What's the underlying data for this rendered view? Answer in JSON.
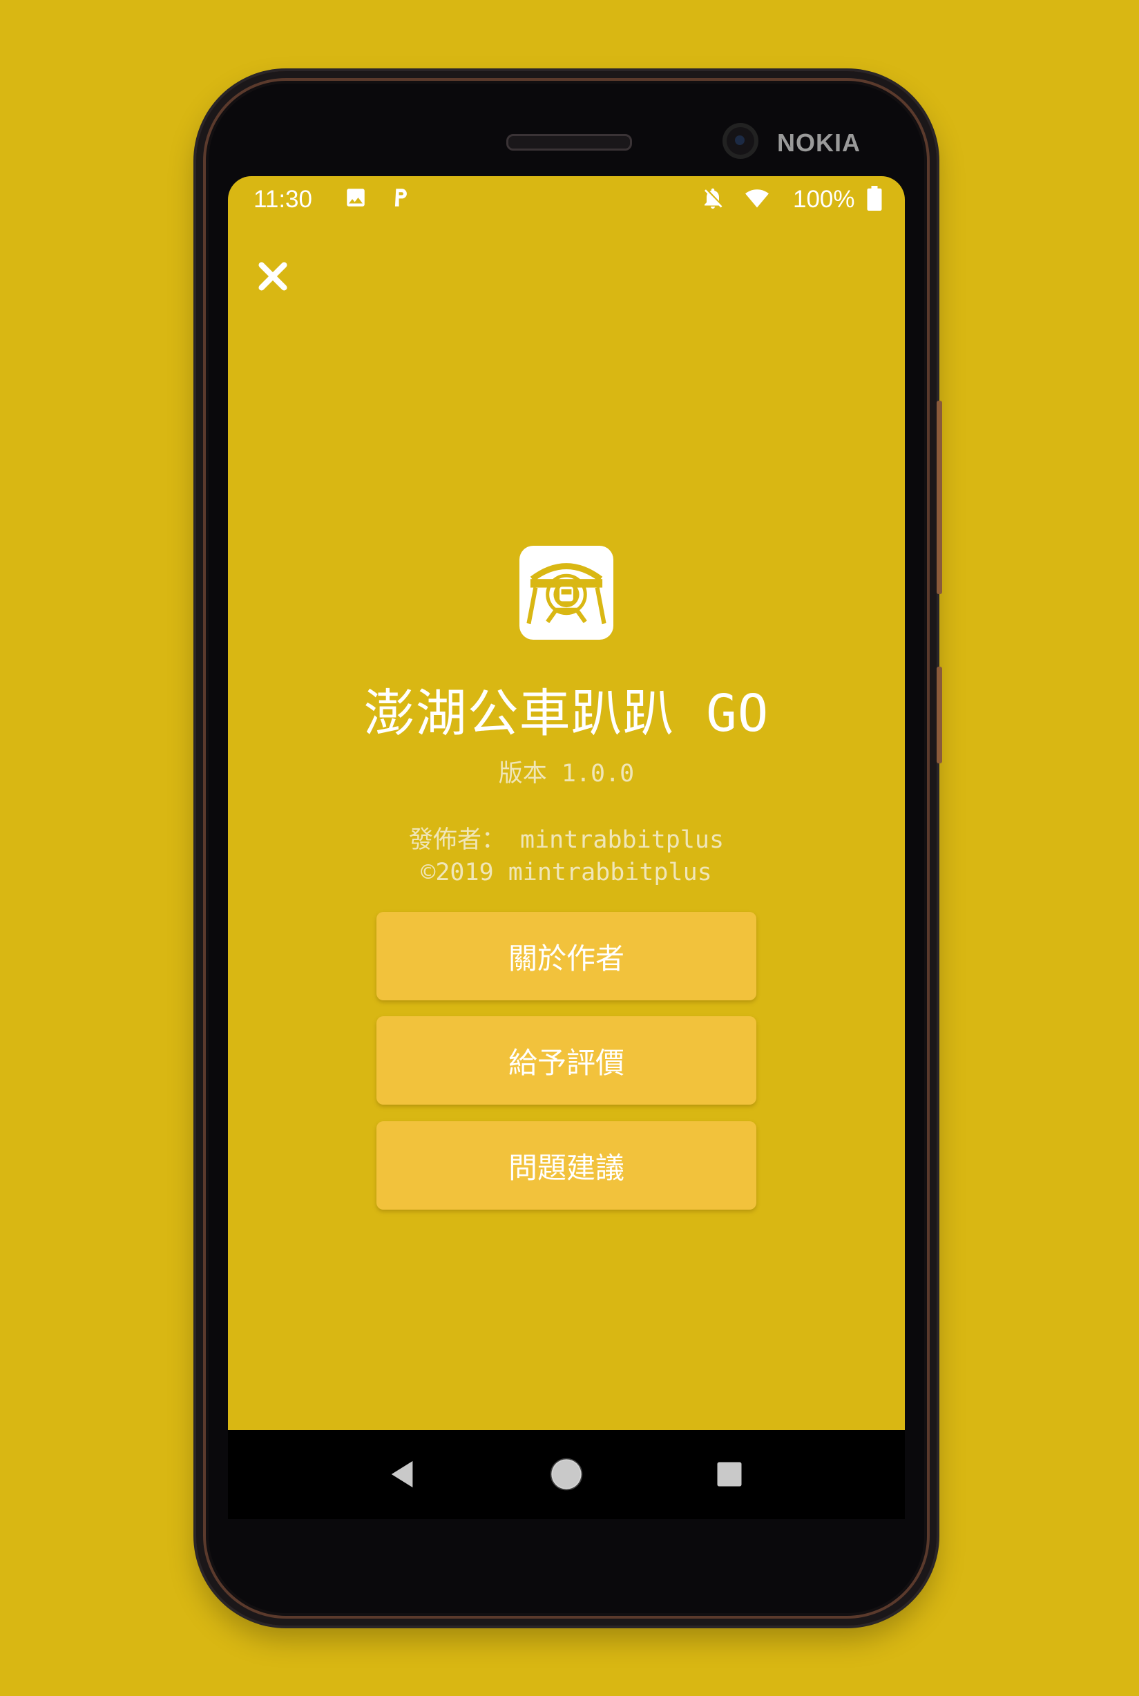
{
  "colors": {
    "background": "#d9b713",
    "button": "#f2c23c",
    "text": "#ffffff",
    "secondary_text": "#f0e6b8",
    "nav_bar": "#000000"
  },
  "device": {
    "brand": "NOKIA"
  },
  "status_bar": {
    "time": "11:30",
    "battery": "100%",
    "icons": [
      "image-icon",
      "parking-app-icon",
      "notifications-off-icon",
      "wifi-icon",
      "battery-icon"
    ]
  },
  "about": {
    "close_icon": "close-icon",
    "app_icon": "bus-app-icon",
    "app_name": "澎湖公車趴趴 GO",
    "version": "版本 1.0.0",
    "publisher": "發佈者： mintrabbitplus",
    "copyright": "©2019 mintrabbitplus"
  },
  "buttons": {
    "about_author": "關於作者",
    "rate": "給予評價",
    "feedback": "問題建議"
  },
  "nav_bar": {
    "icons": [
      "back-icon",
      "home-icon",
      "recents-icon"
    ]
  }
}
